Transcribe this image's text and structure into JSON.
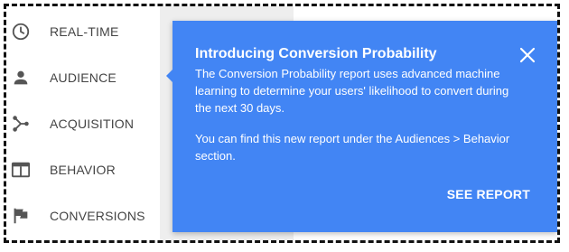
{
  "sidebar": {
    "items": [
      {
        "label": "REAL-TIME",
        "icon": "clock-icon"
      },
      {
        "label": "AUDIENCE",
        "icon": "person-icon"
      },
      {
        "label": "ACQUISITION",
        "icon": "acquisition-branch-icon"
      },
      {
        "label": "BEHAVIOR",
        "icon": "behavior-window-icon"
      },
      {
        "label": "CONVERSIONS",
        "icon": "flag-icon"
      }
    ]
  },
  "popup": {
    "title": "Introducing Conversion Probability",
    "body": "The Conversion Probability report uses advanced machine learning to determine your users' likelihood to convert during the next 30 days.",
    "body2": "You can find this new report under the Audiences > Behavior section.",
    "close_icon": "close-icon",
    "action_label": "SEE REPORT"
  },
  "colors": {
    "popup_background": "#4285f4",
    "sidebar_icon": "#555555",
    "sidebar_text": "#444444",
    "content_gray": "#eeeeee"
  }
}
